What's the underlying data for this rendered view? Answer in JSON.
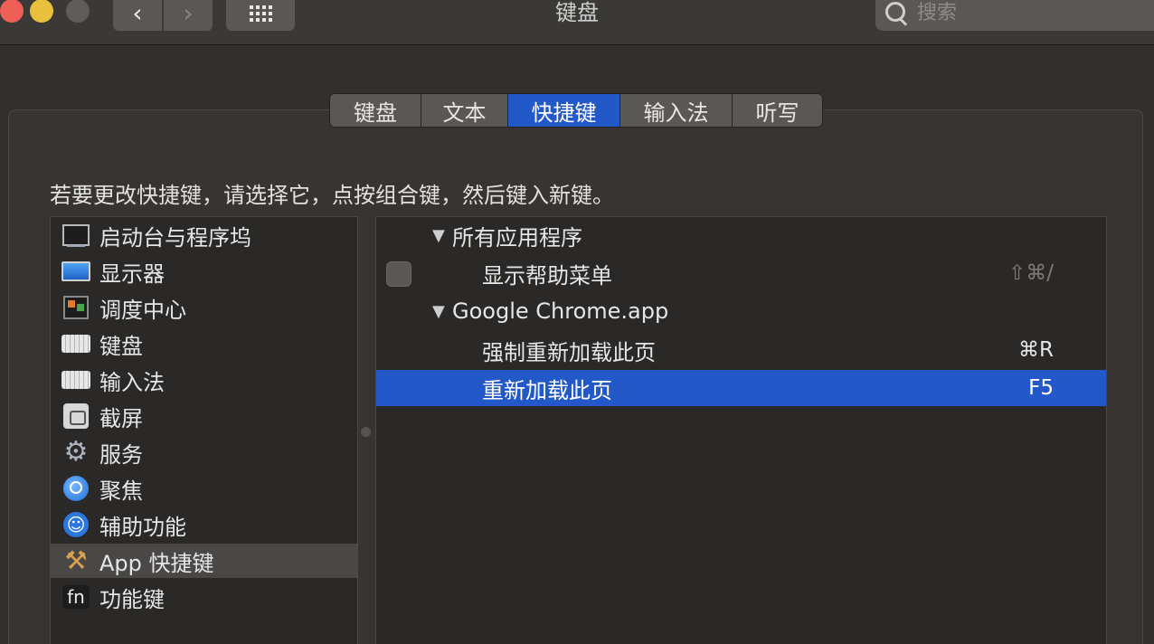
{
  "window": {
    "title": "键盘"
  },
  "toolbar": {
    "back_label": "‹",
    "forward_label": "›"
  },
  "search": {
    "placeholder": "搜索"
  },
  "tabs": [
    {
      "label": "键盘"
    },
    {
      "label": "文本"
    },
    {
      "label": "快捷键",
      "active": true
    },
    {
      "label": "输入法"
    },
    {
      "label": "听写"
    }
  ],
  "instruction": "若要更改快捷键，请选择它，点按组合键，然后键入新键。",
  "categories": [
    {
      "label": "启动台与程序坞",
      "icon": "launchpad-icon"
    },
    {
      "label": "显示器",
      "icon": "display-icon"
    },
    {
      "label": "调度中心",
      "icon": "mission-control-icon"
    },
    {
      "label": "键盘",
      "icon": "keyboard-icon"
    },
    {
      "label": "输入法",
      "icon": "keyboard-icon"
    },
    {
      "label": "截屏",
      "icon": "screenshot-icon"
    },
    {
      "label": "服务",
      "icon": "gear-icon"
    },
    {
      "label": "聚焦",
      "icon": "spotlight-icon"
    },
    {
      "label": "辅助功能",
      "icon": "accessibility-icon"
    },
    {
      "label": "App 快捷键",
      "icon": "app-shortcuts-icon",
      "selected": true
    },
    {
      "label": "功能键",
      "icon": "fn-key-icon",
      "fn_text": "fn"
    }
  ],
  "shortcuts": [
    {
      "label": "所有应用程序",
      "group": true,
      "toggle": "▼"
    },
    {
      "label": "显示帮助菜单",
      "shortcut": "⇧⌘/",
      "checkbox": true,
      "dim": true
    },
    {
      "label": "Google Chrome.app",
      "group": true,
      "toggle": "▼"
    },
    {
      "label": "强制重新加载此页",
      "shortcut": "⌘R"
    },
    {
      "label": "重新加载此页",
      "shortcut": "F5",
      "selected": true
    }
  ],
  "colors": {
    "accent": "#2358c8",
    "close": "#ee5f57",
    "minimize": "#e9bf3c"
  }
}
